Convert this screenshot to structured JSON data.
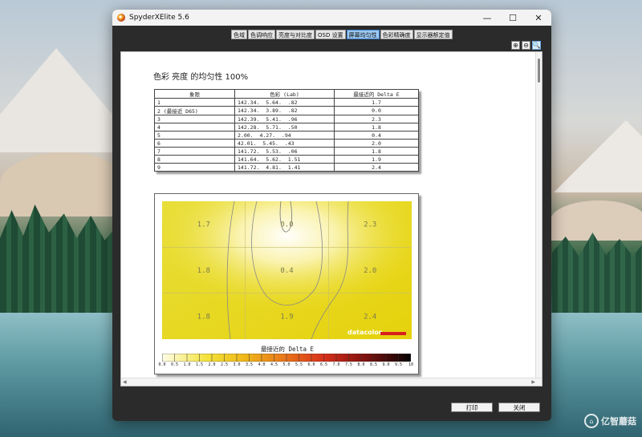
{
  "window": {
    "title": "SpyderXElite 5.6",
    "controls": {
      "minimize": "—",
      "maximize": "☐",
      "close": "✕"
    }
  },
  "tabs": [
    {
      "label": "色域",
      "active": false
    },
    {
      "label": "色调响应",
      "active": false
    },
    {
      "label": "亮度与对比度",
      "active": false
    },
    {
      "label": "OSD 设置",
      "active": false
    },
    {
      "label": "屏幕均匀性",
      "active": true
    },
    {
      "label": "色彩精确度",
      "active": false
    },
    {
      "label": "显示器额定值",
      "active": false
    }
  ],
  "toolbar": {
    "zoom_in": "⊕",
    "zoom_out": "⊖",
    "zoom_fit": "🔍"
  },
  "report": {
    "title": "色彩 亮度 的均匀性 100%",
    "table": {
      "headers": [
        "象限",
        "色彩 (Lab)",
        "最接近的 Delta E"
      ],
      "rows": [
        [
          "1",
          "142.34.  5.64.   .82",
          "1.7"
        ],
        [
          "2 (最接近 D65)",
          "142.34.  3.89.   .82",
          "0.0"
        ],
        [
          "3",
          "142.39.  5.41.   .96",
          "2.3"
        ],
        [
          "4",
          "142.28.  5.71.   .50",
          "1.8"
        ],
        [
          "5",
          "2.00.  4.27.   .94",
          "0.4"
        ],
        [
          "6",
          "42.01.  5.45.   .43",
          "2.0"
        ],
        [
          "7",
          "141.72.  5.53.   .06",
          "1.8"
        ],
        [
          "8",
          "141.64.  5.62.  1.51",
          "1.9"
        ],
        [
          "9",
          "141.72.  4.81.  1.41",
          "2.4"
        ]
      ]
    },
    "map": {
      "cells": [
        "1.7",
        "0.0",
        "2.3",
        "1.8",
        "0.4",
        "2.0",
        "1.8",
        "1.9",
        "2.4"
      ],
      "logo": "datacolor",
      "legend_title": "最接近的 Delta E",
      "legend_ticks": [
        "0.0",
        "0.5",
        "1.0",
        "1.5",
        "2.0",
        "2.5",
        "3.0",
        "3.5",
        "4.0",
        "4.5",
        "5.0",
        "5.5",
        "6.0",
        "6.5",
        "7.0",
        "7.5",
        "8.0",
        "8.5",
        "9.0",
        "9.5",
        "10"
      ],
      "colors": {
        "low": "#fffde8",
        "mid": "#e9d810",
        "high": "#000000",
        "accent": "#d81e1e"
      }
    }
  },
  "footer": {
    "print_label": "打印",
    "close_label": "关闭"
  },
  "watermark": {
    "text": "亿智蘑菇",
    "icon": "mushroom-icon"
  }
}
